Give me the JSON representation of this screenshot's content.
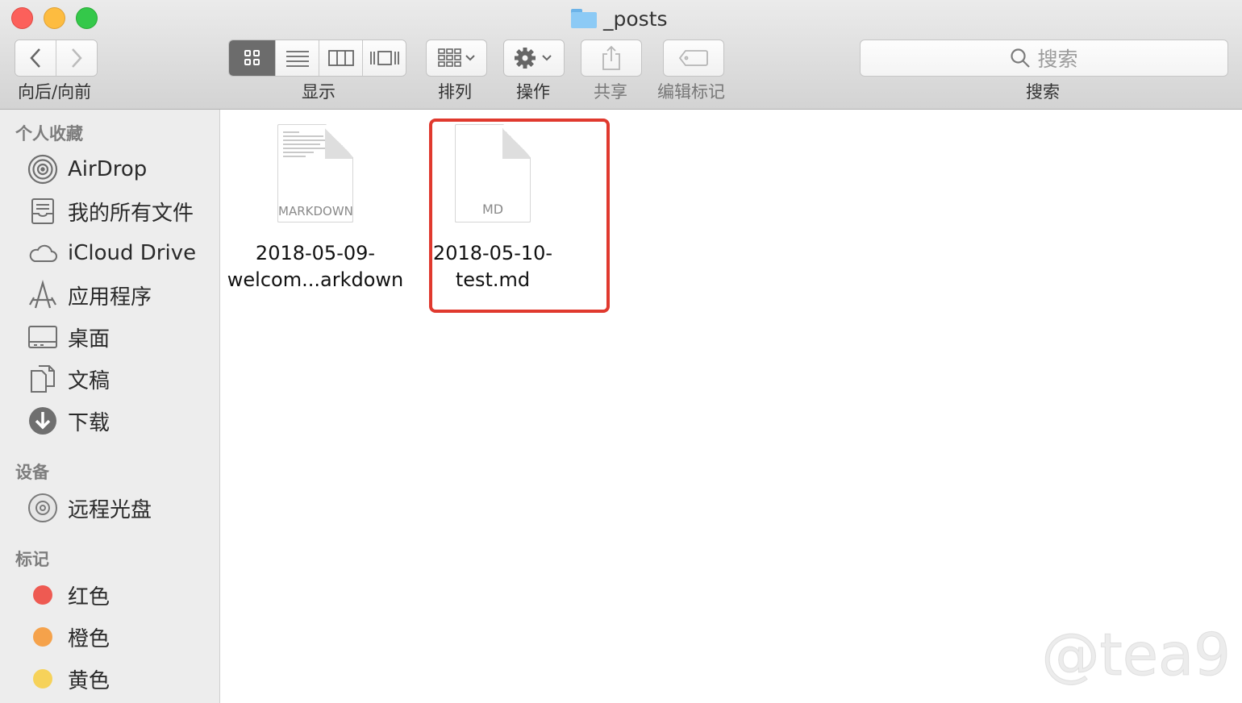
{
  "window": {
    "title": "_posts"
  },
  "toolbar": {
    "nav_label": "向后/向前",
    "view_label": "显示",
    "arrange_label": "排列",
    "action_label": "操作",
    "share_label": "共享",
    "tags_label": "编辑标记",
    "search_label": "搜索",
    "search_placeholder": "搜索"
  },
  "sidebar": {
    "favorites_header": "个人收藏",
    "favorites": [
      {
        "label": "AirDrop",
        "icon": "airdrop-icon"
      },
      {
        "label": "我的所有文件",
        "icon": "all-files-icon"
      },
      {
        "label": "iCloud Drive",
        "icon": "cloud-icon"
      },
      {
        "label": "应用程序",
        "icon": "applications-icon"
      },
      {
        "label": "桌面",
        "icon": "desktop-icon"
      },
      {
        "label": "文稿",
        "icon": "documents-icon"
      },
      {
        "label": "下载",
        "icon": "download-icon"
      }
    ],
    "devices_header": "设备",
    "devices": [
      {
        "label": "远程光盘",
        "icon": "disc-icon"
      }
    ],
    "tags_header": "标记",
    "tags": [
      {
        "label": "红色",
        "color": "#ee5a52"
      },
      {
        "label": "橙色",
        "color": "#f5a24b"
      },
      {
        "label": "黄色",
        "color": "#f6d25a"
      }
    ]
  },
  "files": [
    {
      "name_line1": "2018-05-09-",
      "name_line2": "welcom...arkdown",
      "ext": "MARKDOWN"
    },
    {
      "name_line1": "2018-05-10-",
      "name_line2": "test.md",
      "ext": "MD"
    }
  ],
  "watermark": "@tea9"
}
